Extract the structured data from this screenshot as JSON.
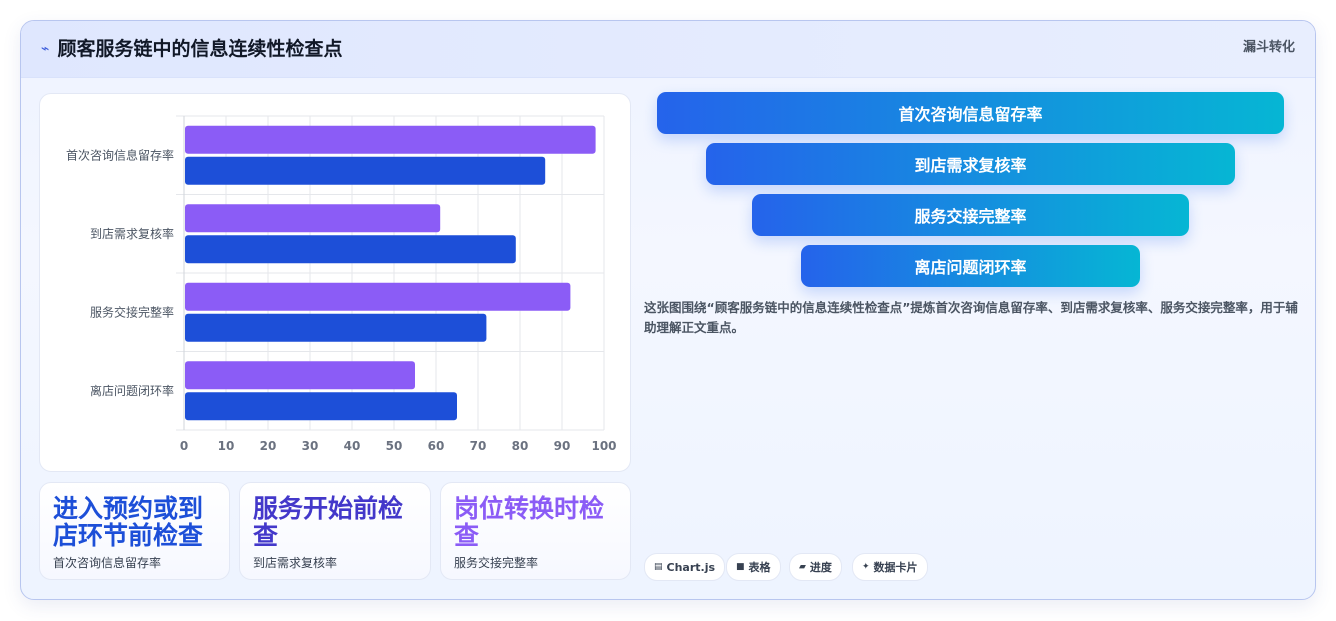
{
  "header": {
    "title": "顾客服务链中的信息连续性检查点",
    "icon": "wave-icon",
    "tag": "漏斗转化"
  },
  "chart_data": {
    "type": "bar",
    "orientation": "horizontal",
    "categories": [
      "首次咨询信息留存率",
      "到店需求复核率",
      "服务交接完整率",
      "离店问题闭环率"
    ],
    "series": [
      {
        "values": [
          98,
          61,
          92,
          55
        ],
        "color": "#8b5cf6"
      },
      {
        "values": [
          86,
          79,
          72,
          65
        ],
        "color": "#1d4fd8"
      }
    ],
    "xlim": [
      0,
      100
    ],
    "xticks": [
      "0",
      "10",
      "20",
      "30",
      "40",
      "50",
      "60",
      "70",
      "80",
      "90",
      "100"
    ],
    "grid": true,
    "legend": "none"
  },
  "kpis": [
    {
      "value": "进入预约或到店环节前检查",
      "label": "首次咨询信息留存率",
      "color": "#1d4fd8"
    },
    {
      "value": "服务开始前检查",
      "label": "到店需求复核率",
      "color": "#4338ca"
    },
    {
      "value": "岗位转换时检查",
      "label": "服务交接完整率",
      "color": "#8b5cf6"
    }
  ],
  "funnel": [
    "首次咨询信息留存率",
    "到店需求复核率",
    "服务交接完整率",
    "离店问题闭环率"
  ],
  "description": "这张图围绕“顾客服务链中的信息连续性检查点”提炼首次咨询信息留存率、到店需求复核率、服务交接完整率，用于辅助理解正文重点。",
  "pills": [
    {
      "label": "Chart.js",
      "icon": "chart-icon",
      "glyph": "▤"
    },
    {
      "label": "表格",
      "icon": "table-icon",
      "glyph": "■"
    },
    {
      "label": "进度",
      "icon": "progress-icon",
      "glyph": "▰"
    },
    {
      "label": "数据卡片",
      "icon": "sparkle-icon",
      "glyph": "✦"
    }
  ]
}
